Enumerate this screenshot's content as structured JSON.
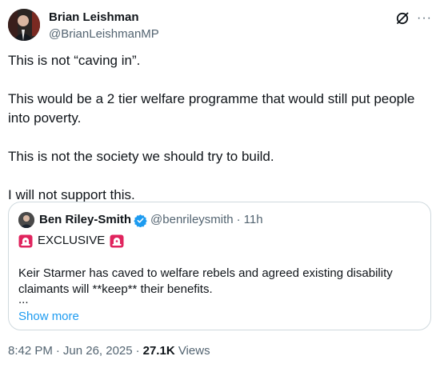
{
  "tweet": {
    "author": {
      "display_name": "Brian Leishman",
      "handle": "@BrianLeishmanMP"
    },
    "icons": [
      "grok-icon",
      "more-options-icon"
    ],
    "more_glyph": "···",
    "body": [
      "This is not “caving in”.",
      "This would be a 2 tier welfare programme that would still put people into poverty.",
      "This is not the society we should try to build.",
      "I will not support this."
    ],
    "quoted": {
      "display_name": "Ben Riley-Smith",
      "verified": true,
      "handle": "@benrileysmith",
      "dot": "·",
      "time": "11h",
      "exclusive_label": "EXCLUSIVE",
      "text": "Keir Starmer has caved to welfare rebels and agreed existing disability claimants will **keep** their benefits.",
      "ellipsis": "...",
      "show_more": "Show more"
    },
    "meta": {
      "time": "8:42 PM",
      "date": "Jun 26, 2025",
      "views_count": "27.1K",
      "views_label": "Views",
      "sep": "·"
    }
  },
  "colors": {
    "text": "#0f1419",
    "secondary": "#536471",
    "link": "#1d9bf0",
    "border": "#cfd9de",
    "verified": "#1d9bf0",
    "siren": "#e0245e"
  }
}
